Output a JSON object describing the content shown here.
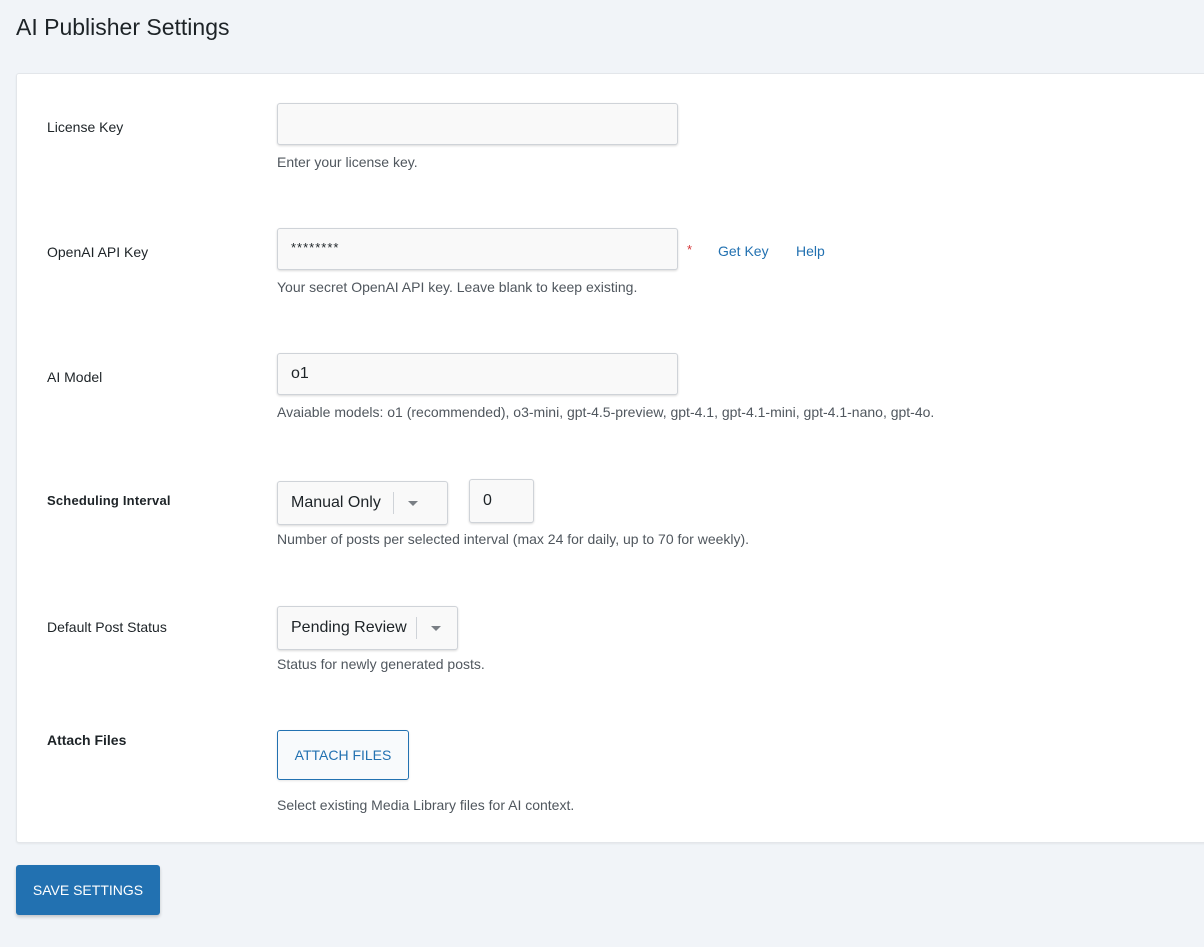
{
  "page": {
    "title": "AI Publisher Settings"
  },
  "license": {
    "label": "License Key",
    "value": "",
    "help": "Enter your license key."
  },
  "openai": {
    "label": "OpenAI API Key",
    "value": "********",
    "required_mark": "*",
    "get_key_link": "Get Key",
    "help_link": "Help",
    "help": "Your secret OpenAI API key. Leave blank to keep existing."
  },
  "model": {
    "label": "AI Model",
    "value": "o1",
    "help": "Avaiable models: o1 (recommended), o3-mini, gpt-4.5-preview, gpt-4.1, gpt-4.1-mini, gpt-4.1-nano, gpt-4o."
  },
  "schedule": {
    "label": "Scheduling Interval",
    "interval_selected": "Manual Only",
    "count": "0",
    "help": "Number of posts per selected interval (max 24 for daily, up to 70 for weekly)."
  },
  "post_status": {
    "label": "Default Post Status",
    "selected": "Pending Review",
    "help": "Status for newly generated posts."
  },
  "attach": {
    "label": "Attach Files",
    "button": "ATTACH FILES",
    "help": "Select existing Media Library files for AI context."
  },
  "actions": {
    "save": "SAVE SETTINGS"
  },
  "colors": {
    "accent": "#2271b1",
    "required": "#d63638",
    "background": "#f1f4f8"
  }
}
